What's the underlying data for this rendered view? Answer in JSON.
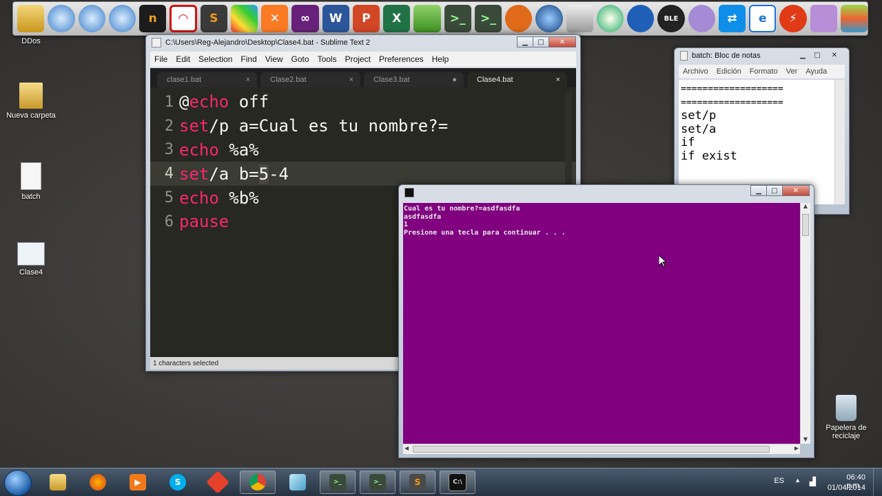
{
  "desktop": {
    "icons": [
      {
        "label": "DDos"
      },
      {
        "label": "Nueva carpeta"
      },
      {
        "label": "batch"
      },
      {
        "label": "Clase4"
      },
      {
        "label": "Papelera de reciclaje"
      }
    ]
  },
  "dock": {
    "icons": [
      "folder-icon",
      "globe-icon",
      "globe-icon",
      "globe-icon",
      "notepad-plus-icon",
      "paint-icon",
      "sublime-icon",
      "paint-brush-icon",
      "xampp-icon",
      "visual-studio-icon",
      "word-icon",
      "powerpoint-icon",
      "excel-icon",
      "app-icon",
      "console-icon",
      "console-icon",
      "cat-icon",
      "earth-icon",
      "camera-icon",
      "app-icon",
      "blender-icon",
      "bluetooth-icon",
      "ghost-icon",
      "teamviewer-icon",
      "ie-icon",
      "flash-icon",
      "feather-icon",
      "bluestacks-icon"
    ]
  },
  "sublime": {
    "title": "C:\\Users\\Reg-Alejandro\\Desktop\\Clase4.bat - Sublime Text 2",
    "menu": [
      "File",
      "Edit",
      "Selection",
      "Find",
      "View",
      "Goto",
      "Tools",
      "Project",
      "Preferences",
      "Help"
    ],
    "tabs": [
      {
        "label": "clase1.bat",
        "mark": "×"
      },
      {
        "label": "Clase2.bat",
        "mark": "×"
      },
      {
        "label": "Clase3.bat",
        "mark": "●"
      },
      {
        "label": "Clase4.bat",
        "mark": "×"
      }
    ],
    "lines": [
      {
        "num": "1",
        "pre": "@",
        "kw": "echo",
        "rest": " off"
      },
      {
        "num": "2",
        "pre": "",
        "kw": "set",
        "rest": "/p a=Cual es tu nombre?="
      },
      {
        "num": "3",
        "pre": "",
        "kw": "echo",
        "rest": " %a%"
      },
      {
        "num": "4",
        "pre": "",
        "kw": "set",
        "rest": "/a b=",
        "sel": "5",
        "after": "-4"
      },
      {
        "num": "5",
        "pre": "",
        "kw": "echo",
        "rest": " %b%"
      },
      {
        "num": "6",
        "pre": "",
        "kw": "pause",
        "rest": ""
      }
    ],
    "status": "1 characters selected"
  },
  "notepad": {
    "title": "batch: Bloc de notas",
    "menu": [
      "Archivo",
      "Edición",
      "Formato",
      "Ver",
      "Ayuda"
    ],
    "lines": [
      "===================",
      "===================",
      "set/p",
      "set/a",
      "if",
      "if exist"
    ]
  },
  "console": {
    "lines": [
      "Cual es tu nombre?=asdfasdfa",
      "asdfasdfa",
      "1",
      "Presione una tecla para continuar . . ."
    ],
    "bg_color": "#800080"
  },
  "taskbar": {
    "apps": [
      "explorer-icon",
      "firefox-icon",
      "media-player-icon",
      "skype-icon",
      "git-icon",
      "chrome-icon",
      "box-icon",
      "console-icon",
      "console-icon",
      "sublime-icon",
      "cmd-icon"
    ],
    "lang": "ES",
    "time": "06:40 p.m.",
    "date": "01/04/2014"
  }
}
